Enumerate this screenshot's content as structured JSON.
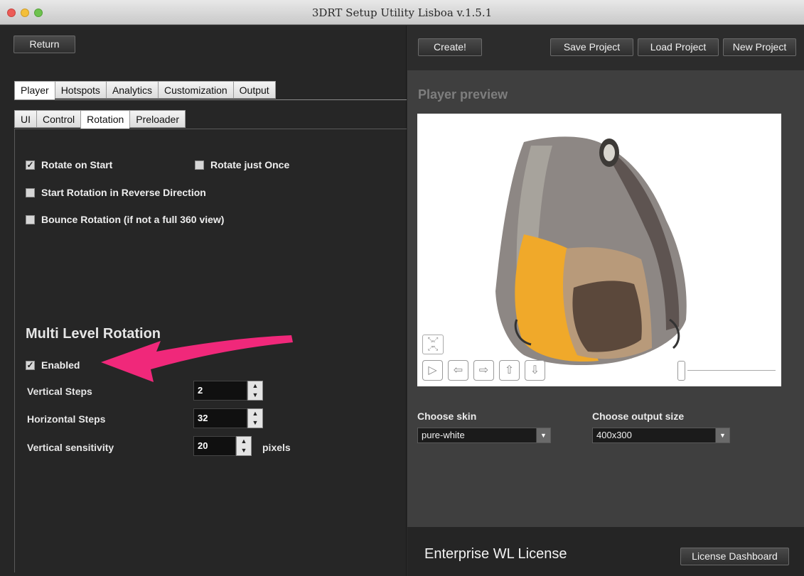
{
  "window": {
    "title": "3DRT Setup Utility Lisboa v.1.5.1"
  },
  "left": {
    "return_label": "Return",
    "main_tabs": [
      "Player",
      "Hotspots",
      "Analytics",
      "Customization",
      "Output"
    ],
    "sub_tabs": [
      "UI",
      "Control",
      "Rotation",
      "Preloader"
    ],
    "options": {
      "rotate_on_start": {
        "label": "Rotate on Start",
        "checked": true
      },
      "rotate_just_once": {
        "label": "Rotate just Once",
        "checked": false
      },
      "reverse_direction": {
        "label": "Start Rotation in Reverse Direction",
        "checked": false
      },
      "bounce_rotation": {
        "label": "Bounce Rotation (if not a full 360 view)",
        "checked": false
      }
    },
    "multi_level": {
      "title": "Multi Level Rotation",
      "enabled": {
        "label": "Enabled",
        "checked": true
      },
      "vertical_steps": {
        "label": "Vertical Steps",
        "value": "2"
      },
      "horizontal_steps": {
        "label": "Horizontal Steps",
        "value": "32"
      },
      "vertical_sensitivity": {
        "label": "Vertical sensitivity",
        "value": "20",
        "unit": "pixels"
      }
    }
  },
  "right": {
    "create_label": "Create!",
    "save_project_label": "Save Project",
    "load_project_label": "Load Project",
    "new_project_label": "New Project",
    "preview_title": "Player preview",
    "skin": {
      "label": "Choose skin",
      "value": "pure-white"
    },
    "output_size": {
      "label": "Choose output size",
      "value": "400x300"
    },
    "license_text": "Enterprise WL License",
    "license_dashboard_label": "License Dashboard"
  },
  "colors": {
    "annotation_arrow": "#f0287a",
    "window_bg": "#2b2b2b",
    "preview_bg": "#ffffff"
  },
  "icons": [
    "fullscreen-icon",
    "play-icon",
    "arrow-left-icon",
    "arrow-right-icon",
    "arrow-up-icon",
    "arrow-down-icon",
    "zoom-slider"
  ]
}
